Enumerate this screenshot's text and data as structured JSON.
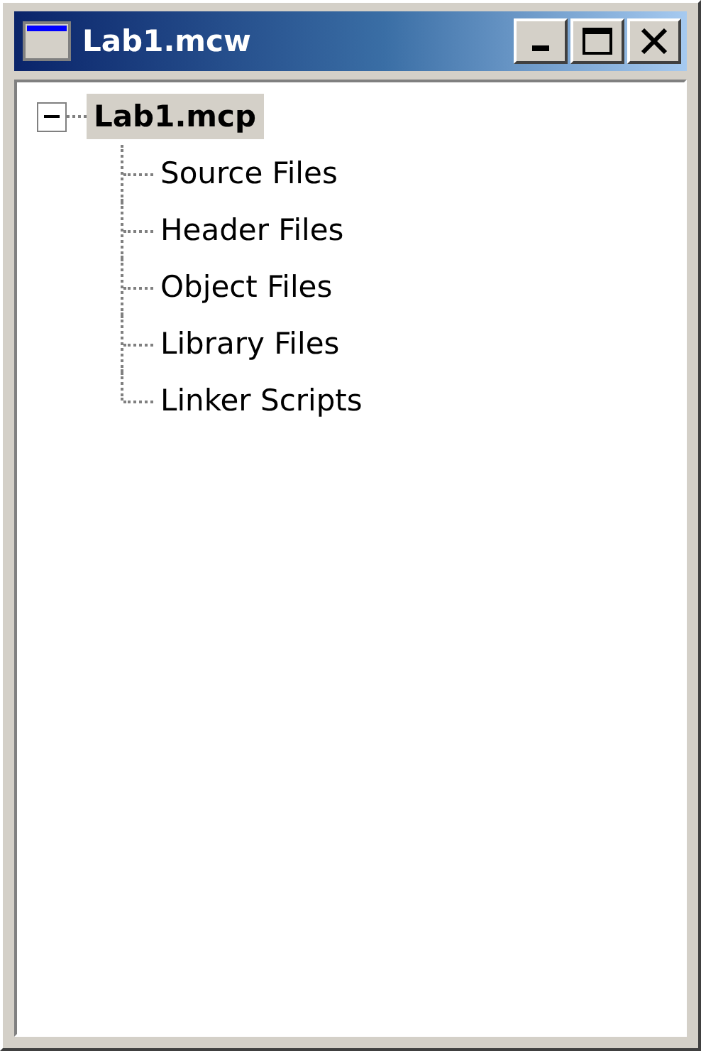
{
  "window": {
    "title": "Lab1.mcw",
    "buttons": [
      {
        "kind": "minimize"
      },
      {
        "kind": "maximize"
      },
      {
        "kind": "close"
      }
    ]
  },
  "tree": [
    {
      "label": "Lab1.mcp",
      "expanded": true,
      "selected": true,
      "children": [
        {
          "label": "Source Files",
          "selected": false
        },
        {
          "label": "Header Files",
          "selected": false
        },
        {
          "label": "Object Files",
          "selected": false
        },
        {
          "label": "Library Files",
          "selected": false
        },
        {
          "label": "Linker Scripts",
          "selected": false
        }
      ]
    }
  ]
}
